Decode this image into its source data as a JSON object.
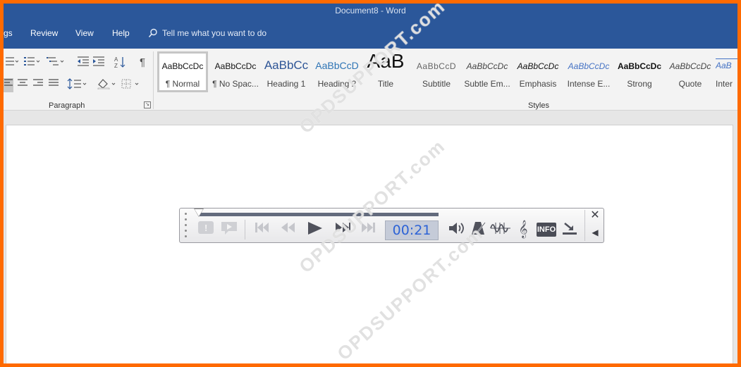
{
  "window": {
    "title": "Document8  -  Word"
  },
  "menu": {
    "partial_first": "gs",
    "items": [
      "Review",
      "View",
      "Help"
    ],
    "tell_me": "Tell me what you want to do"
  },
  "ribbon": {
    "paragraph_label": "Paragraph",
    "styles_label": "Styles",
    "pilcrow": "¶",
    "styles": [
      {
        "preview": "AaBbCcDc",
        "name": "¶ Normal"
      },
      {
        "preview": "AaBbCcDc",
        "name": "¶ No Spac..."
      },
      {
        "preview": "AaBbCc",
        "name": "Heading 1"
      },
      {
        "preview": "AaBbCcD",
        "name": "Heading 2"
      },
      {
        "preview": "AaB",
        "name": "Title"
      },
      {
        "preview": "AaBbCcD",
        "name": "Subtitle"
      },
      {
        "preview": "AaBbCcDc",
        "name": "Subtle Em..."
      },
      {
        "preview": "AaBbCcDc",
        "name": "Emphasis"
      },
      {
        "preview": "AaBbCcDc",
        "name": "Intense E..."
      },
      {
        "preview": "AaBbCcDc",
        "name": "Strong"
      },
      {
        "preview": "AaBbCcDc",
        "name": "Quote"
      },
      {
        "preview": "AaB",
        "name": "Inter"
      }
    ]
  },
  "player": {
    "time": "00:21",
    "info_label": "INFO",
    "close_glyph": "✕",
    "collapse_glyph": "◀"
  },
  "watermark": {
    "text": "OPDSUPPORT.com"
  },
  "colors": {
    "frame_border": "#ff6a00",
    "title_bar": "#2b579a",
    "time_text": "#2d63d6"
  }
}
